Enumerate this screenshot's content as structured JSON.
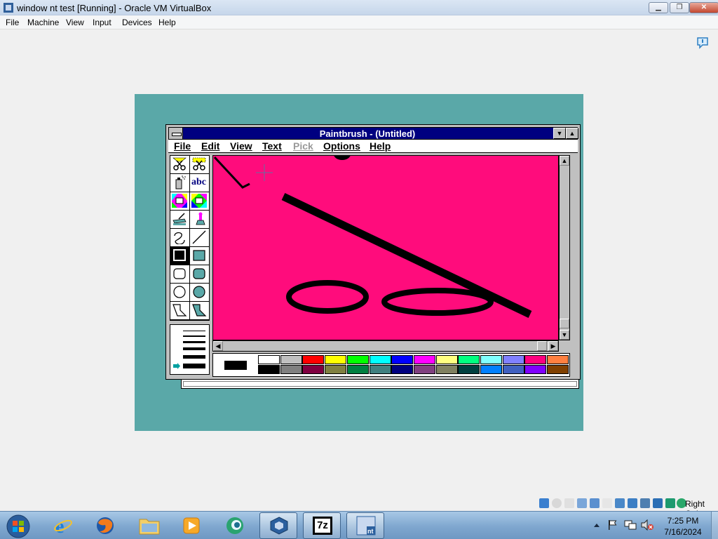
{
  "host": {
    "window_title": "window nt test [Running] - Oracle VM VirtualBox",
    "menu": [
      "File",
      "Machine",
      "View",
      "Input",
      "Devices",
      "Help"
    ],
    "host_key": "Right Ctrl"
  },
  "paintbrush": {
    "title": "Paintbrush - (Untitled)",
    "menu": [
      {
        "label": "File",
        "enabled": true
      },
      {
        "label": "Edit",
        "enabled": true
      },
      {
        "label": "View",
        "enabled": true
      },
      {
        "label": "Text",
        "enabled": true
      },
      {
        "label": "Pick",
        "enabled": false
      },
      {
        "label": "Options",
        "enabled": true
      },
      {
        "label": "Help",
        "enabled": true
      }
    ],
    "tools": [
      "scissors-icon",
      "pick-scissors-icon",
      "airbrush-icon",
      "text-tool-icon",
      "color-eraser-icon",
      "eraser-icon",
      "paint-roller-icon",
      "brush-icon",
      "curve-icon",
      "line-icon",
      "box-icon",
      "filled-box-icon",
      "rounded-box-icon",
      "filled-rounded-box-icon",
      "circle-icon",
      "filled-circle-icon",
      "polygon-icon",
      "filled-polygon-icon"
    ],
    "text_tool_label": "abc",
    "selected_tool": "box-icon",
    "selected_line_width_index": 5,
    "canvas_color": "#ff0c7c",
    "foreground_color": "#000000",
    "background_color": "#ffffff",
    "palette_top": [
      "#ffffff",
      "#c0c0c0",
      "#ff0000",
      "#ffff00",
      "#00ff00",
      "#00ffff",
      "#0000ff",
      "#ff00ff",
      "#ffff80",
      "#00ff80",
      "#80ffff",
      "#8080ff",
      "#ff0080",
      "#ff8040"
    ],
    "palette_bottom": [
      "#000000",
      "#808080",
      "#800040",
      "#808040",
      "#008040",
      "#408080",
      "#000080",
      "#804080",
      "#808060",
      "#004040",
      "#0080ff",
      "#4060c0",
      "#8000ff",
      "#804000"
    ]
  },
  "taskbar": {
    "items": [
      "start-orb-icon",
      "internet-explorer-icon",
      "firefox-icon",
      "folder-icon",
      "media-player-icon",
      "app-icon",
      "virtualbox-icon",
      "7zip-icon",
      "windows-nt-icon"
    ],
    "tray_7zip_label": "7z",
    "clock_time": "7:25 PM",
    "clock_date": "7/16/2024"
  }
}
